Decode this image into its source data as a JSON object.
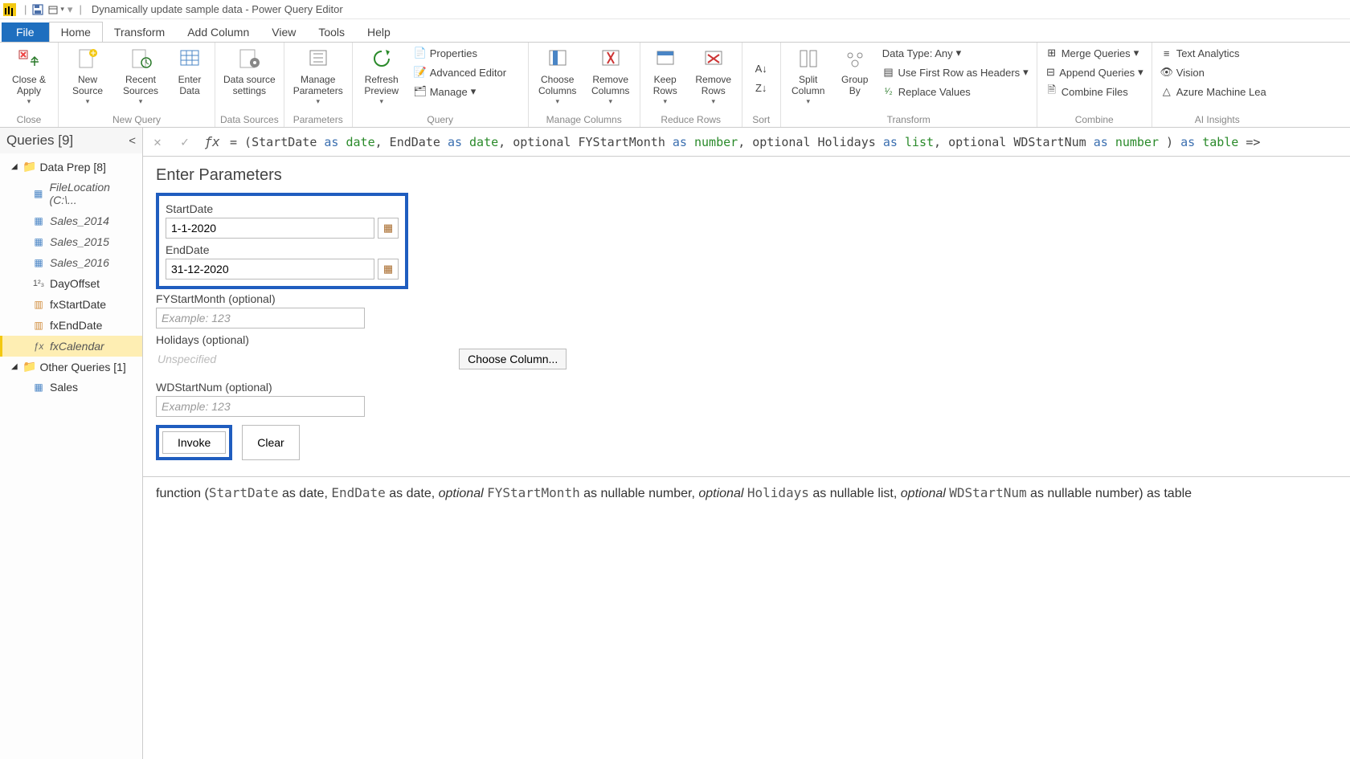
{
  "window": {
    "title": "Dynamically update sample data - Power Query Editor"
  },
  "menu": {
    "file": "File",
    "home": "Home",
    "transform": "Transform",
    "addcolumn": "Add Column",
    "view": "View",
    "tools": "Tools",
    "help": "Help"
  },
  "ribbon": {
    "close": {
      "label": "Close &\nApply",
      "group": "Close"
    },
    "newsource": "New\nSource",
    "recentsources": "Recent\nSources",
    "enterdata": "Enter\nData",
    "newquery_group": "New Query",
    "datasourcesettings": "Data source\nsettings",
    "datasources_group": "Data Sources",
    "manageparameters": "Manage\nParameters",
    "parameters_group": "Parameters",
    "refreshpreview": "Refresh\nPreview",
    "properties": "Properties",
    "advancededitor": "Advanced Editor",
    "manage": "Manage",
    "query_group": "Query",
    "choosecolumns": "Choose\nColumns",
    "removecolumns": "Remove\nColumns",
    "managecolumns_group": "Manage Columns",
    "keeprows": "Keep\nRows",
    "removerows": "Remove\nRows",
    "reducerows_group": "Reduce Rows",
    "sort_group": "Sort",
    "splitcolumn": "Split\nColumn",
    "groupby": "Group\nBy",
    "datatype": "Data Type: Any",
    "firstrowheaders": "Use First Row as Headers",
    "replacevalues": "Replace Values",
    "transform_group": "Transform",
    "mergequeries": "Merge Queries",
    "appendqueries": "Append Queries",
    "combinefiles": "Combine Files",
    "combine_group": "Combine",
    "textanalytics": "Text Analytics",
    "vision": "Vision",
    "azureml": "Azure Machine Lea",
    "aiinsights_group": "AI Insights"
  },
  "queries": {
    "header": "Queries [9]",
    "group1": "Data Prep [8]",
    "items1": [
      "FileLocation (C:\\...",
      "Sales_2014",
      "Sales_2015",
      "Sales_2016",
      "DayOffset",
      "fxStartDate",
      "fxEndDate",
      "fxCalendar"
    ],
    "group2": "Other Queries [1]",
    "items2": [
      "Sales"
    ]
  },
  "formula": {
    "prefix": "= (StartDate ",
    "as1": "as",
    "t1": "date",
    "s1": ", EndDate ",
    "as2": "as",
    "t2": "date",
    "s2": ", optional FYStartMonth ",
    "as3": "as",
    "t3": "number",
    "s3": ", optional Holidays ",
    "as4": "as",
    "t4": "list",
    "s4": ", optional WDStartNum ",
    "as5": "as",
    "t5": "number",
    "s5": " ) ",
    "as6": "as",
    "t6": "table",
    "s6": " =>"
  },
  "params": {
    "title": "Enter Parameters",
    "startdate": {
      "label": "StartDate",
      "value": "1-1-2020"
    },
    "enddate": {
      "label": "EndDate",
      "value": "31-12-2020"
    },
    "fystartmonth": {
      "label": "FYStartMonth (optional)",
      "placeholder": "Example: 123"
    },
    "holidays": {
      "label": "Holidays (optional)",
      "unspecified": "Unspecified",
      "choose": "Choose Column..."
    },
    "wdstartnum": {
      "label": "WDStartNum (optional)",
      "placeholder": "Example: 123"
    },
    "invoke": "Invoke",
    "clear": "Clear"
  },
  "signature": {
    "fn": "function (",
    "p1": "StartDate",
    "p1t": " as date, ",
    "p2": "EndDate",
    "p2t": " as date, ",
    "opt1": "optional ",
    "p3": "FYStartMonth",
    "p3t": " as nullable number, ",
    "opt2": "optional ",
    "p4": "Holidays",
    "p4t": " as nullable list, ",
    "opt3": "optional ",
    "p5": "WDStartNum",
    "p5t": " as nullable number) as table"
  }
}
